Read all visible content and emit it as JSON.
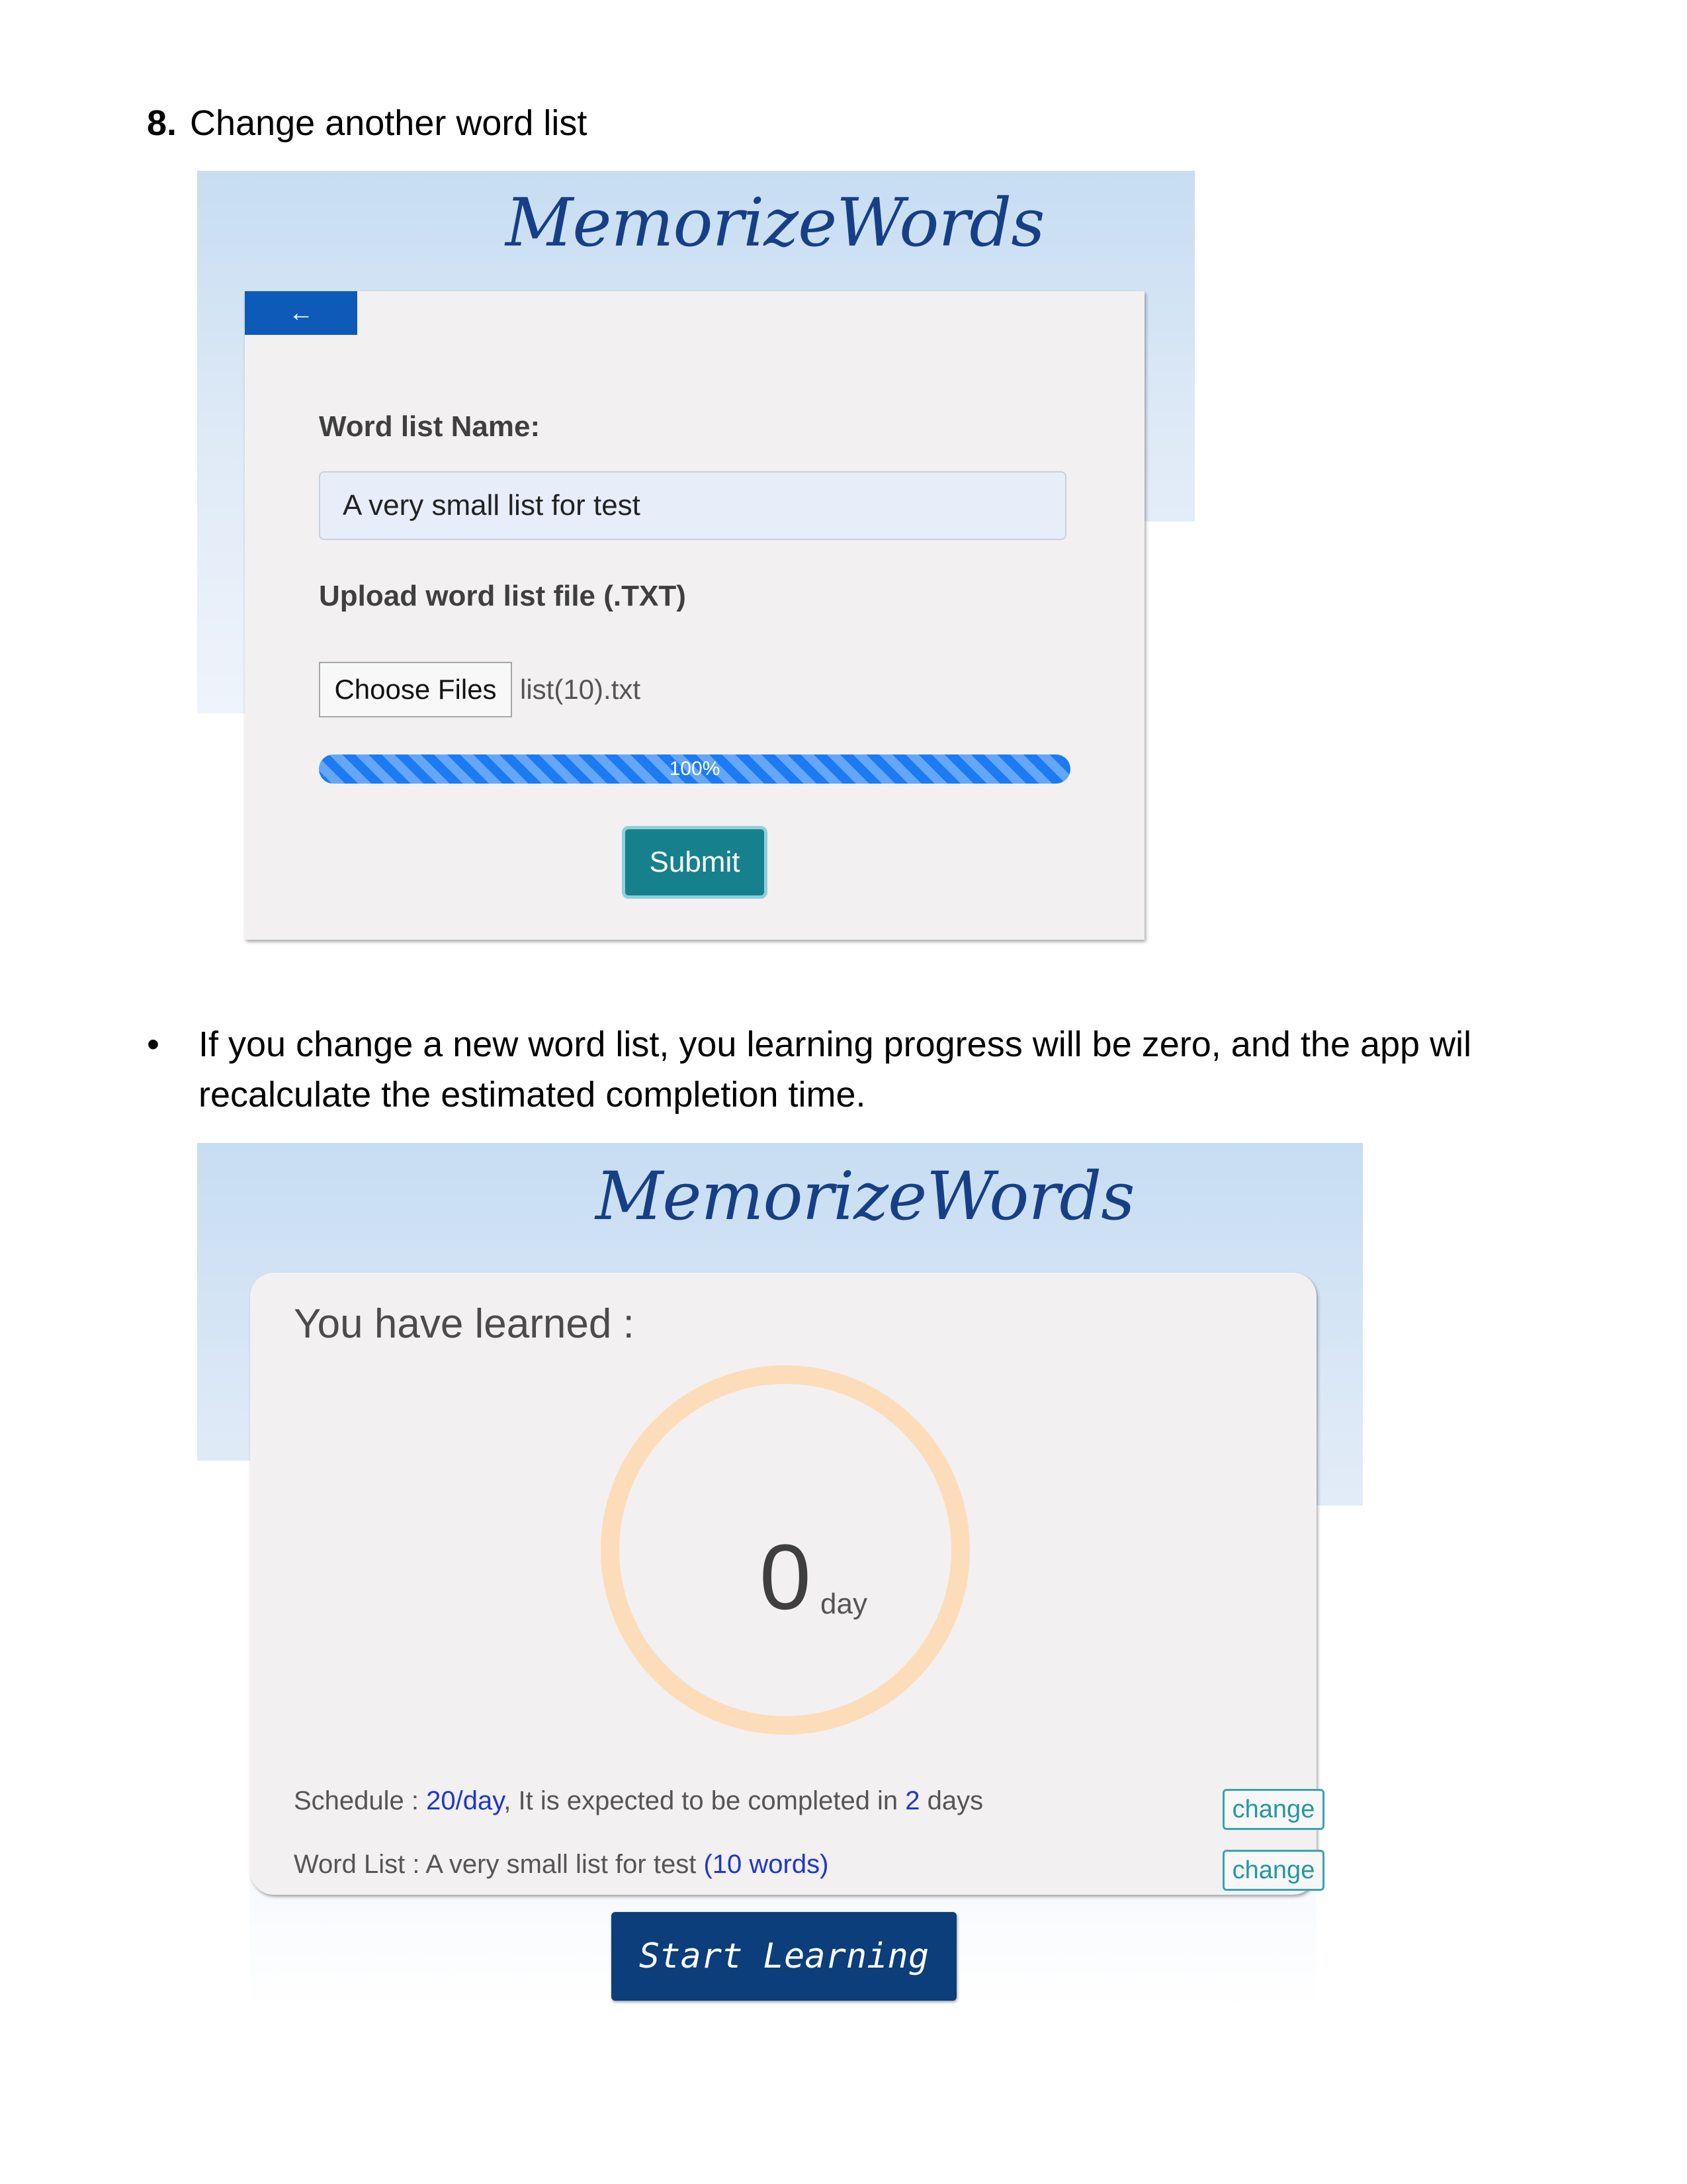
{
  "heading": {
    "number": "8.",
    "text": "Change another word list"
  },
  "form_screen": {
    "logo": "MemorizeWords",
    "back_label": "←",
    "name_label": "Word list Name:",
    "name_value": "A very small list for test",
    "upload_label": "Upload word list file (.TXT)",
    "choose_button": "Choose Files",
    "file_name": "list(10).txt",
    "progress_text": "100%",
    "progress_value": 100,
    "submit_label": "Submit"
  },
  "bullet": {
    "symbol": "•",
    "text": "If you change a new word list, you learning progress will be zero, and the app wil recalculate the estimated completion time."
  },
  "progress_screen": {
    "logo": "MemorizeWords",
    "learned_label": "You have learned :",
    "days_value": "0",
    "days_unit": "day",
    "schedule_label": "Schedule : ",
    "schedule_value": "20/day",
    "schedule_mid": ", It is expected to be completed in ",
    "schedule_days": "2",
    "schedule_end": " days",
    "wordlist_label": "Word List : A very small list for test ",
    "wordlist_count": "(10 words)",
    "change_label_1": "change",
    "change_label_2": "change",
    "start_label": "Start Learning"
  },
  "colors": {
    "primary_blue": "#0d5ab8",
    "submit_teal": "#17808d",
    "start_navy": "#0b3e7a",
    "ring_peach": "#fddcb9",
    "link_blue": "#1f37c9"
  }
}
